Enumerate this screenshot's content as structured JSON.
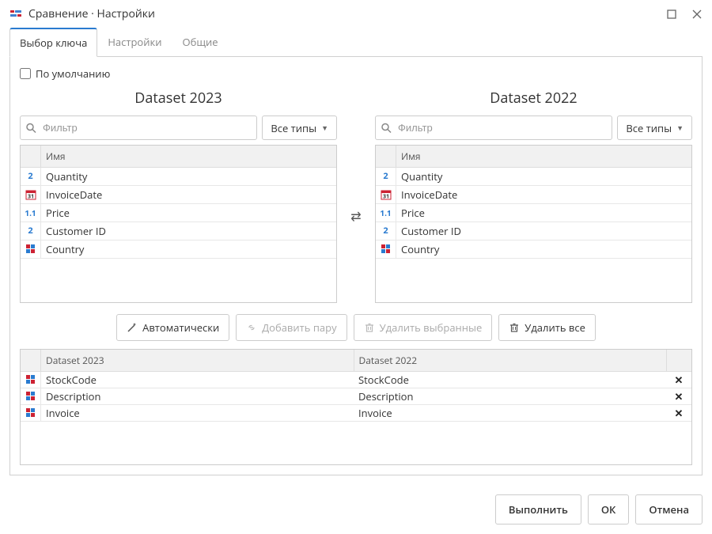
{
  "window": {
    "title": "Сравнение · Настройки"
  },
  "tabs": [
    {
      "label": "Выбор ключа",
      "active": true
    },
    {
      "label": "Настройки",
      "active": false
    },
    {
      "label": "Общие",
      "active": false
    }
  ],
  "checkbox": {
    "label": "По умолчанию",
    "checked": false
  },
  "filter": {
    "placeholder": "Фильтр",
    "type_label": "Все типы"
  },
  "left_panel": {
    "title": "Dataset 2023",
    "header": {
      "name": "Имя"
    },
    "rows": [
      {
        "type": "int",
        "name": "Quantity"
      },
      {
        "type": "date",
        "name": "InvoiceDate"
      },
      {
        "type": "float",
        "name": "Price"
      },
      {
        "type": "int",
        "name": "Customer ID"
      },
      {
        "type": "str",
        "name": "Country"
      }
    ]
  },
  "right_panel": {
    "title": "Dataset 2022",
    "header": {
      "name": "Имя"
    },
    "rows": [
      {
        "type": "int",
        "name": "Quantity"
      },
      {
        "type": "date",
        "name": "InvoiceDate"
      },
      {
        "type": "float",
        "name": "Price"
      },
      {
        "type": "int",
        "name": "Customer ID"
      },
      {
        "type": "str",
        "name": "Country"
      }
    ]
  },
  "toolbar": {
    "auto": "Автоматически",
    "add_pair": "Добавить пару",
    "delete_selected": "Удалить выбранные",
    "delete_all": "Удалить все"
  },
  "pairs": {
    "header_a": "Dataset 2023",
    "header_b": "Dataset 2022",
    "rows": [
      {
        "type": "str",
        "a": "StockCode",
        "b": "StockCode"
      },
      {
        "type": "str",
        "a": "Description",
        "b": "Description"
      },
      {
        "type": "str",
        "a": "Invoice",
        "b": "Invoice"
      }
    ]
  },
  "footer": {
    "run": "Выполнить",
    "ok": "ОК",
    "cancel": "Отмена"
  }
}
